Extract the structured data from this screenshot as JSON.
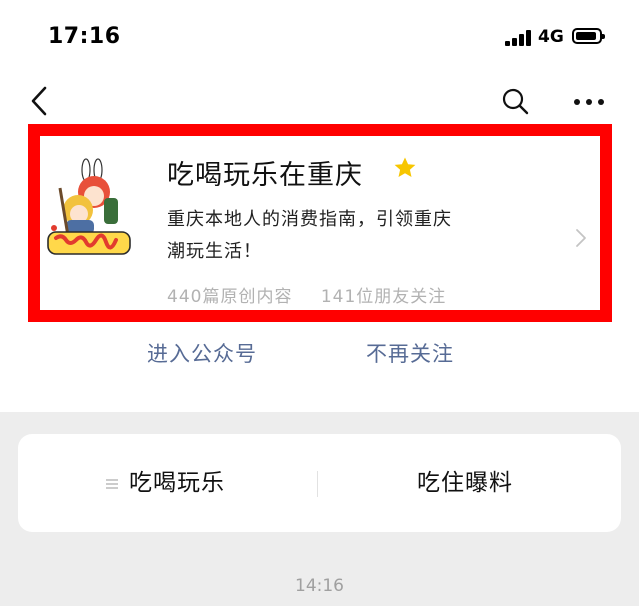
{
  "status_bar": {
    "time": "17:16",
    "network": "4G",
    "battery_level": 0.75
  },
  "nav": {
    "back_icon": "chevron-left-icon",
    "search_icon": "search-icon",
    "more_icon": "more-dots-icon"
  },
  "account": {
    "name": "吃喝玩乐在重庆",
    "description": "重庆本地人的消费指南，引领重庆潮玩生活！",
    "original_count": "440篇原创内容",
    "friends_following": "141位朋友关注",
    "star_color": "#f7c600",
    "highlight_color": "#ff0000"
  },
  "actions": {
    "enter_label": "进入公众号",
    "unfollow_label": "不再关注",
    "link_color": "#576b95"
  },
  "menu": {
    "items": [
      {
        "label": "吃喝玩乐"
      },
      {
        "label": "吃住曝料"
      }
    ]
  },
  "chat": {
    "timestamp": "14:16"
  }
}
